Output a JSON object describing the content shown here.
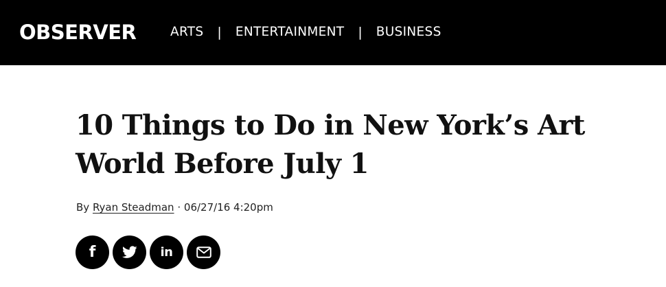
{
  "header": {
    "logo": "OBSERVER",
    "nav": [
      {
        "label": "ARTS"
      },
      {
        "label": "ENTERTAINMENT"
      },
      {
        "label": "BUSINESS"
      }
    ],
    "separator": "|"
  },
  "article": {
    "headline": "10 Things to Do in New York’s Art World Before July 1",
    "byline": {
      "prefix": "By",
      "author": "Ryan Steadman",
      "divider": "·",
      "timestamp": "06/27/16 4:20pm"
    }
  },
  "share": {
    "buttons": [
      {
        "icon": "facebook-icon",
        "glyph": "f"
      },
      {
        "icon": "twitter-icon"
      },
      {
        "icon": "linkedin-icon",
        "glyph": "in"
      },
      {
        "icon": "email-icon"
      }
    ]
  },
  "colors": {
    "bar_background": "#000000",
    "text": "#111111",
    "button_background": "#000000",
    "icon": "#ffffff"
  }
}
